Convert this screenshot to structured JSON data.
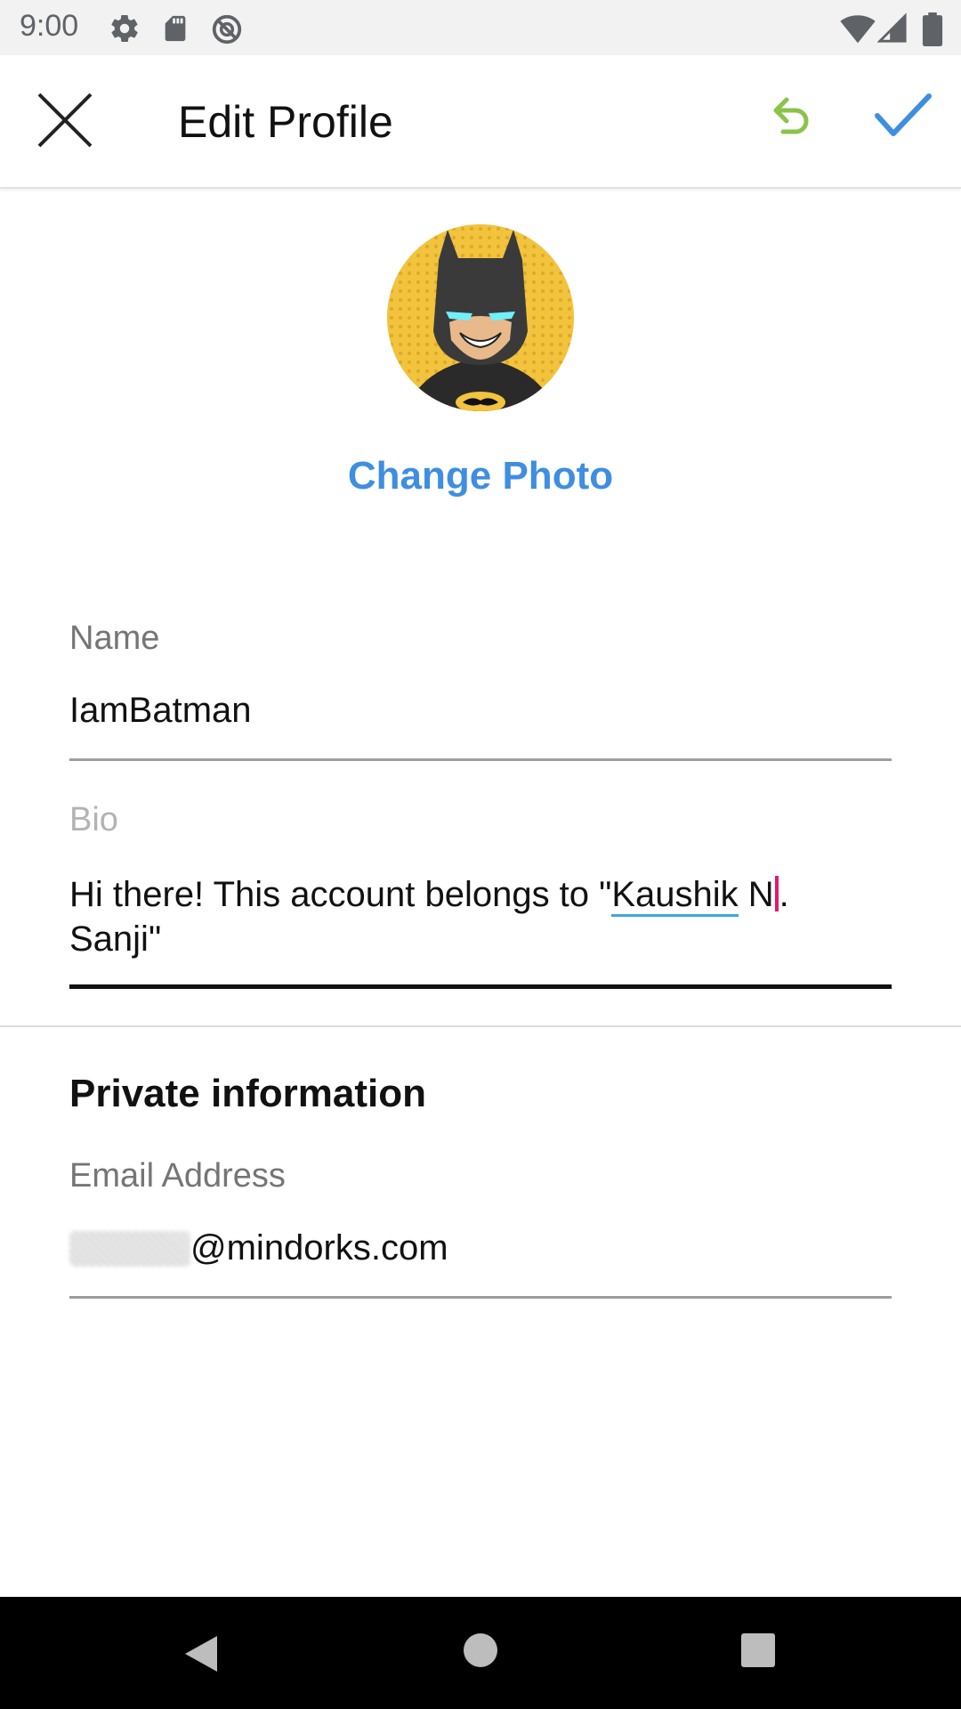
{
  "status_bar": {
    "time": "9:00",
    "icons": [
      "gear-icon",
      "sd-card-icon",
      "no-sync-icon",
      "wifi-icon",
      "signal-icon",
      "battery-icon"
    ]
  },
  "app_bar": {
    "title": "Edit Profile",
    "close_icon": "close-icon",
    "undo_icon": "undo-icon",
    "confirm_icon": "checkmark-icon",
    "colors": {
      "undo": "#8bc34a",
      "confirm": "#3f8ee0"
    }
  },
  "profile": {
    "avatar": "batman-avatar",
    "change_photo_label": "Change Photo"
  },
  "form": {
    "name_label": "Name",
    "name_value": "IamBatman",
    "bio_label": "Bio",
    "bio_text_before": "Hi there! This account belongs to \"",
    "bio_link_word": "Kaushik",
    "bio_text_after_link": " N",
    "bio_text_after_caret": ".",
    "bio_line2": "Sanji\""
  },
  "private_info": {
    "section_title": "Private information",
    "email_label": "Email Address",
    "email_domain": "@mindorks.com"
  },
  "nav_bar": {
    "buttons": [
      "back-icon",
      "home-icon",
      "recents-icon"
    ]
  }
}
